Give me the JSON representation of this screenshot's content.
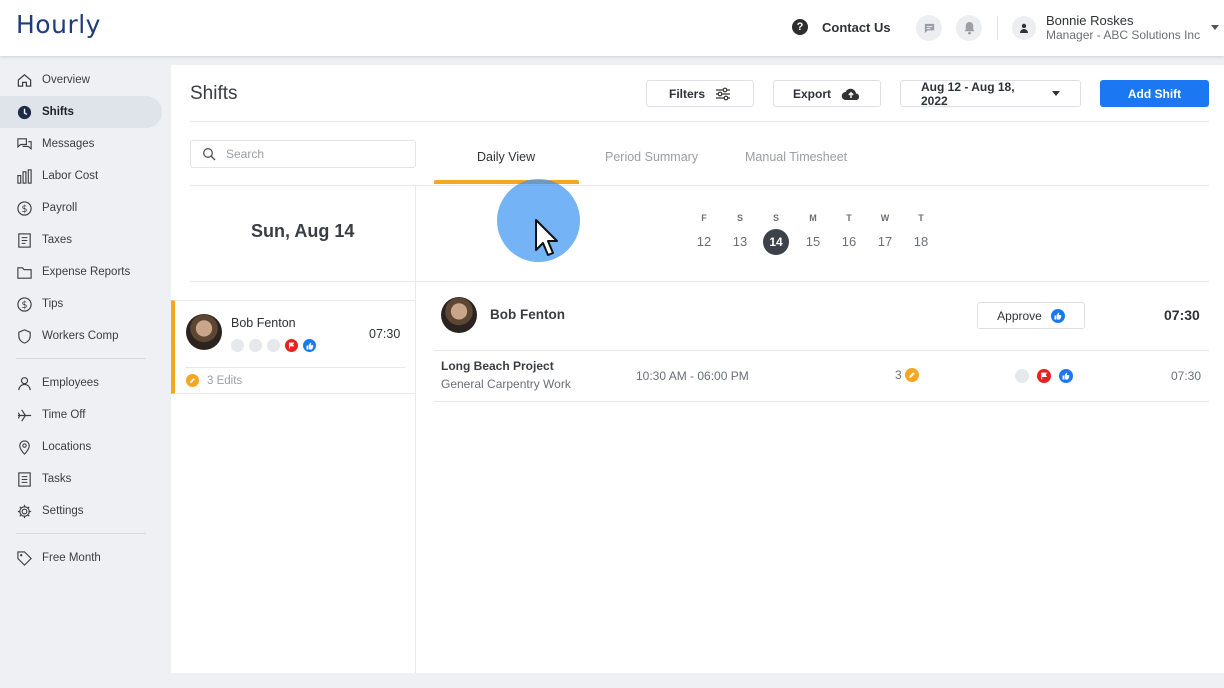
{
  "app": {
    "logo": "Hourly"
  },
  "topbar": {
    "contact_label": "Contact Us",
    "user_name": "Bonnie Roskes",
    "user_role": "Manager - ABC Solutions Inc"
  },
  "sidebar": {
    "items": [
      {
        "label": "Overview",
        "icon": "home-icon"
      },
      {
        "label": "Shifts",
        "icon": "clock-icon",
        "active": true
      },
      {
        "label": "Messages",
        "icon": "chat-icon"
      },
      {
        "label": "Labor Cost",
        "icon": "bar-chart-icon"
      },
      {
        "label": "Payroll",
        "icon": "dollar-icon"
      },
      {
        "label": "Taxes",
        "icon": "document-icon"
      },
      {
        "label": "Expense Reports",
        "icon": "folder-icon"
      },
      {
        "label": "Tips",
        "icon": "dollar-icon"
      },
      {
        "label": "Workers Comp",
        "icon": "shield-icon"
      },
      {
        "label": "Employees",
        "icon": "person-icon"
      },
      {
        "label": "Time Off",
        "icon": "plane-icon"
      },
      {
        "label": "Locations",
        "icon": "pin-icon"
      },
      {
        "label": "Tasks",
        "icon": "list-icon"
      },
      {
        "label": "Settings",
        "icon": "gear-icon"
      },
      {
        "label": "Free Month",
        "icon": "tag-icon"
      }
    ]
  },
  "header": {
    "title": "Shifts",
    "filters_label": "Filters",
    "export_label": "Export",
    "date_range": "Aug 12 - Aug 18, 2022",
    "add_shift_label": "Add Shift"
  },
  "search": {
    "placeholder": "Search"
  },
  "tabs": [
    {
      "label": "Daily View",
      "active": true
    },
    {
      "label": "Period Summary"
    },
    {
      "label": "Manual Timesheet"
    }
  ],
  "day": {
    "current_date": "Sun, Aug 14",
    "week": [
      {
        "letter": "F",
        "num": "12"
      },
      {
        "letter": "S",
        "num": "13"
      },
      {
        "letter": "S",
        "num": "14",
        "selected": true
      },
      {
        "letter": "M",
        "num": "15"
      },
      {
        "letter": "T",
        "num": "16"
      },
      {
        "letter": "W",
        "num": "17"
      },
      {
        "letter": "T",
        "num": "18"
      }
    ]
  },
  "employee": {
    "name": "Bob Fenton",
    "total": "07:30",
    "edits": "3 Edits",
    "approve_label": "Approve"
  },
  "shift": {
    "project": "Long Beach Project",
    "role": "General Carpentry Work",
    "time_range": "10:30 AM - 06:00 PM",
    "edit_count": "3",
    "hours": "07:30"
  },
  "colors": {
    "accent_orange": "#f5a623",
    "primary_blue": "#1b78f2",
    "flag_red": "#e8231f",
    "logo_navy": "#1d3d7a"
  }
}
